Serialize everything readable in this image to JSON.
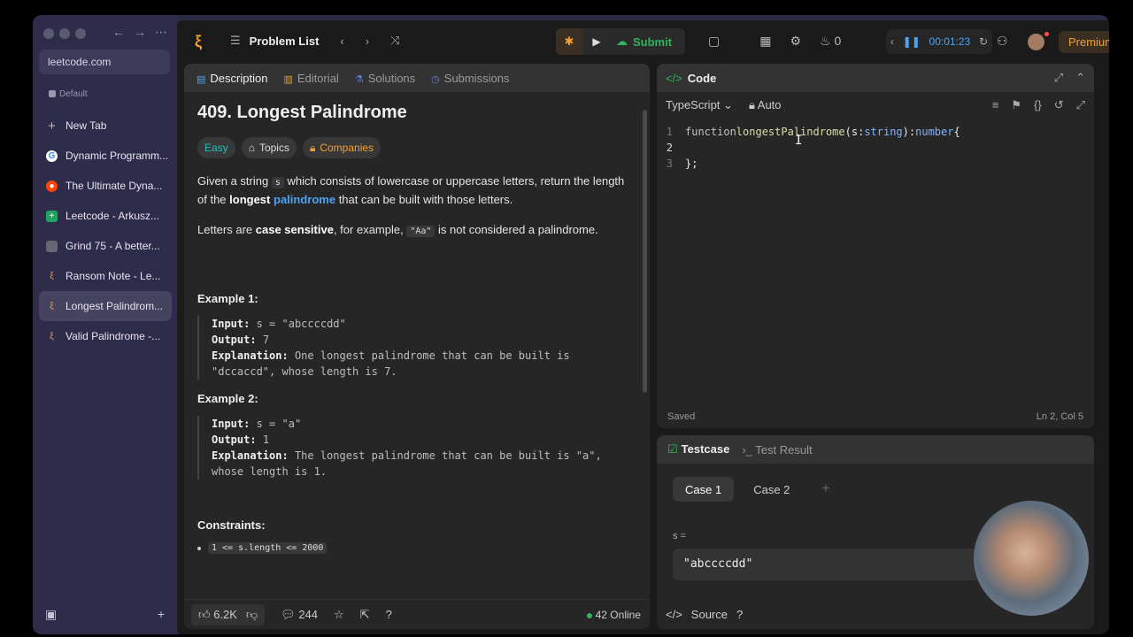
{
  "browser": {
    "url": "leetcode.com",
    "space_label": "Default",
    "new_tab": "New Tab",
    "tabs": [
      {
        "label": "Dynamic Programm...",
        "icon": "google-icon",
        "color": "#ffffff"
      },
      {
        "label": "The Ultimate Dyna...",
        "icon": "reddit-icon",
        "color": "#ff4500"
      },
      {
        "label": "Leetcode - Arkusz...",
        "icon": "sheets-icon",
        "color": "#1fa463"
      },
      {
        "label": "Grind 75 - A better...",
        "icon": "grind-icon",
        "color": "#666677"
      },
      {
        "label": "Ransom Note - Le...",
        "icon": "leetcode-icon",
        "color": "#f0a030"
      },
      {
        "label": "Longest Palindrom...",
        "icon": "leetcode-icon",
        "color": "#f0a030"
      },
      {
        "label": "Valid Palindrome -...",
        "icon": "leetcode-icon",
        "color": "#f0a030"
      }
    ]
  },
  "topbar": {
    "problem_list": "Problem List",
    "submit": "Submit",
    "streak": "0",
    "timer": "00:01:23",
    "premium": "Premium"
  },
  "left_panel": {
    "tabs": [
      "Description",
      "Editorial",
      "Solutions",
      "Submissions"
    ],
    "title": "409. Longest Palindrome",
    "chips": {
      "difficulty": "Easy",
      "topics": "Topics",
      "companies": "Companies"
    },
    "desc_1a": "Given a string ",
    "desc_1_code": "s",
    "desc_1b": " which consists of lowercase or uppercase letters, return the length of the ",
    "desc_1_bold": "longest",
    "desc_1_link": "palindrome",
    "desc_1c": " that can be built with those letters.",
    "desc_2a": "Letters are ",
    "desc_2_bold": "case sensitive",
    "desc_2b": ", for example, ",
    "desc_2_code": "\"Aa\"",
    "desc_2c": " is not considered a palindrome.",
    "example1": {
      "heading": "Example 1:",
      "input_label": "Input:",
      "input": "s = \"abccccdd\"",
      "output_label": "Output:",
      "output": "7",
      "expl_label": "Explanation:",
      "expl": "One longest palindrome that can be built is \"dccaccd\", whose length is 7."
    },
    "example2": {
      "heading": "Example 2:",
      "input_label": "Input:",
      "input": "s = \"a\"",
      "output_label": "Output:",
      "output": "1",
      "expl_label": "Explanation:",
      "expl": "The longest palindrome that can be built is \"a\", whose length is 1."
    },
    "constraints_heading": "Constraints:",
    "constraint_1": "1 <= s.length <= 2000",
    "likes": "6.2K",
    "comments": "244",
    "online": "42 Online"
  },
  "code_panel": {
    "title": "Code",
    "language": "TypeScript",
    "mode": "Auto",
    "lines": [
      {
        "num": "1",
        "kw": "function ",
        "fn": "longestPalindrome",
        "rest": "(s: ",
        "ty": "string",
        "rest2": "): ",
        "ty2": "number",
        "end": " {"
      },
      {
        "num": "2"
      },
      {
        "num": "3",
        "end": "};"
      }
    ],
    "status_left": "Saved",
    "status_right": "Ln 2, Col 5"
  },
  "test_panel": {
    "tab_testcase": "Testcase",
    "tab_result": "Test Result",
    "cases": [
      "Case 1",
      "Case 2"
    ],
    "var_label": "s =",
    "var_value": "\"abccccdd\"",
    "source": "Source"
  }
}
